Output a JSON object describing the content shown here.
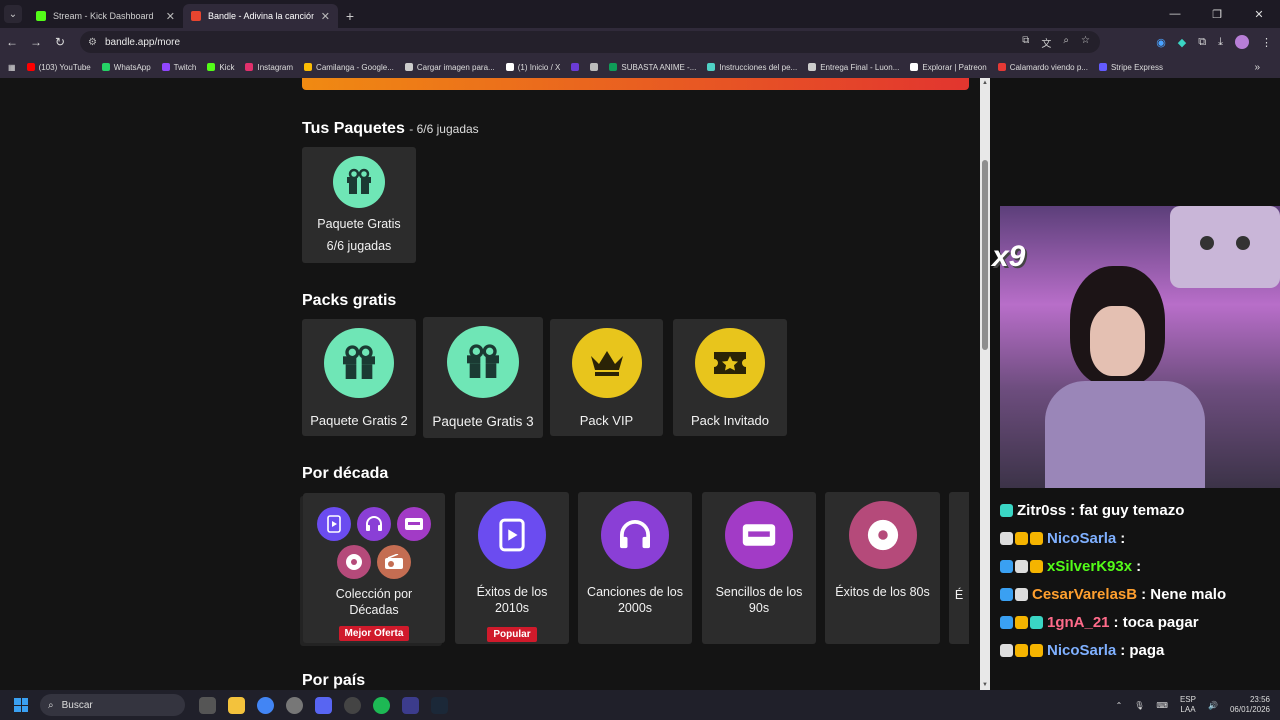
{
  "browser": {
    "tabs": [
      {
        "title": "Stream - Kick Dashboard",
        "color": "#53fc18",
        "active": false
      },
      {
        "title": "Bandle - Adivina la canción, un",
        "color": "#e8452f",
        "active": true
      }
    ],
    "url": "bandle.app/more",
    "bookmarks": [
      {
        "label": "(103) YouTube",
        "color": "#ff0000"
      },
      {
        "label": "WhatsApp",
        "color": "#25d366"
      },
      {
        "label": "Twitch",
        "color": "#9146ff"
      },
      {
        "label": "Kick",
        "color": "#53fc18"
      },
      {
        "label": "Instagram",
        "color": "#e1306c"
      },
      {
        "label": "Camilanga - Google...",
        "color": "#fbbc04"
      },
      {
        "label": "Cargar imagen para...",
        "color": "#cccccc"
      },
      {
        "label": "(1) Inicio / X",
        "color": "#ffffff"
      },
      {
        "label": "",
        "color": "#6a3bd6"
      },
      {
        "label": "",
        "color": "#bbbbbb"
      },
      {
        "label": "SUBASTA ANIME -...",
        "color": "#0f9d58"
      },
      {
        "label": "Instrucciones del pe...",
        "color": "#4fd1c5"
      },
      {
        "label": "Entrega Final - Luon...",
        "color": "#cccccc"
      },
      {
        "label": "Explorar | Patreon",
        "color": "#ffffff"
      },
      {
        "label": "Calamardo viendo p...",
        "color": "#e53935"
      },
      {
        "label": "Stripe Express",
        "color": "#635bff"
      }
    ]
  },
  "page": {
    "tus_paquetes": {
      "title": "Tus Paquetes",
      "subtitle": "- 6/6 jugadas",
      "card": {
        "label": "Paquete Gratis",
        "sub": "6/6 jugadas",
        "icon": "gift-icon"
      }
    },
    "packs_gratis": {
      "title": "Packs gratis",
      "cards": [
        {
          "label": "Paquete Gratis 2",
          "icon": "gift-icon"
        },
        {
          "label": "Paquete Gratis 3",
          "icon": "gift-icon"
        },
        {
          "label": "Pack VIP",
          "icon": "crown-icon"
        },
        {
          "label": "Pack Invitado",
          "icon": "ticket-star-icon"
        }
      ]
    },
    "por_decada": {
      "title": "Por década",
      "cards": [
        {
          "label": "Colección por Décadas",
          "badge": "Mejor Oferta"
        },
        {
          "label": "Éxitos de los 2010s",
          "badge": "Popular",
          "color": "#6b4cf0",
          "icon": "phone-icon"
        },
        {
          "label": "Canciones de los 2000s",
          "color": "#8a3fd6",
          "icon": "headphones-icon"
        },
        {
          "label": "Sencillos de los 90s",
          "color": "#a23bc6",
          "icon": "cassette-icon"
        },
        {
          "label": "Éxitos de los 80s",
          "color": "#b54a7a",
          "icon": "vinyl-icon"
        },
        {
          "label": "É"
        }
      ]
    },
    "por_pais": {
      "title": "Por país"
    }
  },
  "stream": {
    "multiplier": "x9",
    "chat": [
      {
        "user": "Zitr0ss",
        "color": "#ffffff",
        "text": ": fat guy temazo",
        "badges": [
          "#3ad6c4"
        ]
      },
      {
        "user": "NicoSarla",
        "color": "#7fb0ff",
        "text": ":",
        "badges": [
          "#dddddd",
          "#f5b400",
          "#f5b400"
        ]
      },
      {
        "user": "xSilverK93x",
        "color": "#53fc18",
        "text": ":",
        "badges": [
          "#3aa0f2",
          "#dddddd",
          "#f5b400"
        ]
      },
      {
        "user": "CesarVarelasB",
        "color": "#ff9f2e",
        "text": ": Nene malo",
        "badges": [
          "#3aa0f2",
          "#dddddd"
        ]
      },
      {
        "user": "1gnA_21",
        "color": "#ff6b8a",
        "text": ": toca pagar",
        "badges": [
          "#3aa0f2",
          "#f5b400",
          "#3ad6c4"
        ]
      },
      {
        "user": "NicoSarla",
        "color": "#7fb0ff",
        "text": ": paga",
        "badges": [
          "#dddddd",
          "#f5b400",
          "#f5b400"
        ]
      }
    ]
  },
  "taskbar": {
    "search_placeholder": "Buscar",
    "lang_line1": "ESP",
    "lang_line2": "LAA",
    "time": "23:56",
    "date": "06/01/2026"
  }
}
